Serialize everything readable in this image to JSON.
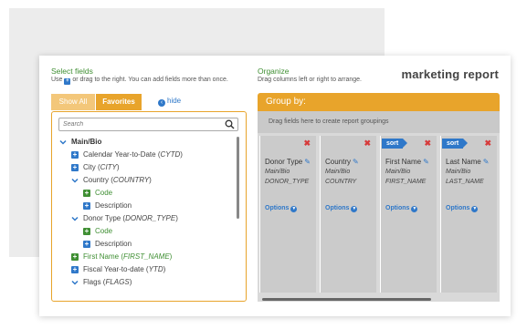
{
  "select_fields": {
    "title": "Select fields",
    "hint_before": "Use",
    "hint_after": "or drag to the right. You can add fields more than once."
  },
  "organize": {
    "title": "Organize",
    "hint": "Drag columns left or right to arrange."
  },
  "report_title": "marketing report",
  "tabs": {
    "show_all": "Show All",
    "favorites": "Favorites",
    "hide": "hide"
  },
  "search": {
    "placeholder": "Search"
  },
  "tree": [
    {
      "type": "chevron",
      "label": "Main/Bio",
      "style": "bold"
    },
    {
      "type": "plus-blue",
      "label": "Calendar Year-to-Date (",
      "code": "CYTD",
      "style": ""
    },
    {
      "type": "plus-blue",
      "label": "City (",
      "code": "CITY",
      "style": ""
    },
    {
      "type": "chevron",
      "label": "Country (",
      "code": "COUNTRY",
      "style": ""
    },
    {
      "type": "plus-green",
      "label": "Code",
      "style": "green"
    },
    {
      "type": "plus-blue",
      "label": "Description",
      "style": ""
    },
    {
      "type": "chevron",
      "label": "Donor Type (",
      "code": "DONOR_TYPE",
      "style": ""
    },
    {
      "type": "plus-green",
      "label": "Code",
      "style": "green"
    },
    {
      "type": "plus-blue",
      "label": "Description",
      "style": ""
    },
    {
      "type": "plus-green",
      "label": "First Name (",
      "code": "FIRST_NAME",
      "style": "green"
    },
    {
      "type": "plus-blue",
      "label": "Fiscal Year-to-date (",
      "code": "YTD",
      "style": ""
    },
    {
      "type": "chevron",
      "label": "Flags (",
      "code": "FLAGS",
      "style": ""
    }
  ],
  "group_by": {
    "title": "Group by:",
    "drop_hint": "Drag fields here to create report groupings"
  },
  "columns": [
    {
      "name": "Donor Type",
      "path": "Main/Bio",
      "field": "DONOR_TYPE",
      "sort": false,
      "options": "Options",
      "remove": "✖"
    },
    {
      "name": "Country",
      "path": "Main/Bio",
      "field": "COUNTRY",
      "sort": false,
      "options": "Options",
      "remove": "✖"
    },
    {
      "name": "First Name",
      "path": "Main/Bio",
      "field": "FIRST_NAME",
      "sort": true,
      "sort_label": "sort",
      "options": "Options",
      "remove": "✖"
    },
    {
      "name": "Last Name",
      "path": "Main/Bio",
      "field": "LAST_NAME",
      "sort": true,
      "sort_label": "sort",
      "options": "Options",
      "remove": "✖"
    }
  ],
  "colors": {
    "accent_orange": "#e8a42b",
    "link_blue": "#2f78c9",
    "field_green": "#3f8f33",
    "remove_red": "#d63b3b"
  }
}
